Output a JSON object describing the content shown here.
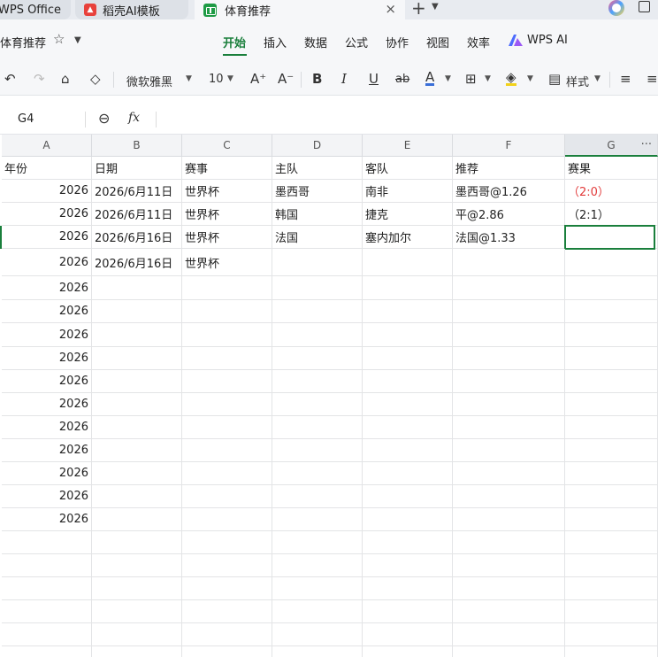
{
  "tabs": {
    "wps": "WPS Office",
    "daoke": "稻壳AI模板",
    "active": "体育推荐",
    "close": "×",
    "new": "+",
    "arrow": "⌄"
  },
  "doc": {
    "name": "体育推荐"
  },
  "menu": {
    "items": [
      "开始",
      "插入",
      "数据",
      "公式",
      "协作",
      "视图",
      "效率",
      "WPS AI"
    ],
    "active_index": 0
  },
  "toolbar": {
    "font_name": "微软雅黑",
    "font_size": "10",
    "style_label": "样式"
  },
  "formula": {
    "cell_ref": "G4",
    "fx": "fx",
    "value": ""
  },
  "sheet": {
    "columns": [
      "A",
      "B",
      "C",
      "D",
      "E",
      "F",
      "G"
    ],
    "selected_column": "G",
    "rows": [
      [
        "年份",
        "日期",
        "赛事",
        "主队",
        "客队",
        "推荐",
        "赛果"
      ],
      [
        "2026",
        "2026/6月11日",
        "世界杯",
        "墨西哥",
        "南非",
        "墨西哥@1.26",
        "（2:0）"
      ],
      [
        "2026",
        "2026/6月11日",
        "世界杯",
        "韩国",
        "捷克",
        "平@2.86",
        "（2:1）"
      ],
      [
        "2026",
        "2026/6月16日",
        "世界杯",
        "法国",
        "塞内加尔",
        "法国@1.33",
        ""
      ],
      [
        "2026",
        "2026/6月16日",
        "世界杯",
        "",
        "",
        "",
        ""
      ],
      [
        "2026",
        "",
        "",
        "",
        "",
        "",
        ""
      ],
      [
        "2026",
        "",
        "",
        "",
        "",
        "",
        ""
      ],
      [
        "2026",
        "",
        "",
        "",
        "",
        "",
        ""
      ],
      [
        "2026",
        "",
        "",
        "",
        "",
        "",
        ""
      ],
      [
        "2026",
        "",
        "",
        "",
        "",
        "",
        ""
      ],
      [
        "2026",
        "",
        "",
        "",
        "",
        "",
        ""
      ],
      [
        "2026",
        "",
        "",
        "",
        "",
        "",
        ""
      ],
      [
        "2026",
        "",
        "",
        "",
        "",
        "",
        ""
      ],
      [
        "2026",
        "",
        "",
        "",
        "",
        "",
        ""
      ],
      [
        "2026",
        "",
        "",
        "",
        "",
        "",
        ""
      ],
      [
        "2026",
        "",
        "",
        "",
        "",
        "",
        ""
      ],
      [
        "",
        "",
        "",
        "",
        "",
        "",
        ""
      ],
      [
        "",
        "",
        "",
        "",
        "",
        "",
        ""
      ],
      [
        "",
        "",
        "",
        "",
        "",
        "",
        ""
      ],
      [
        "",
        "",
        "",
        "",
        "",
        "",
        ""
      ],
      [
        "",
        "",
        "",
        "",
        "",
        "",
        ""
      ],
      [
        "",
        "",
        "",
        "",
        "",
        "",
        ""
      ]
    ],
    "colors": {
      "accent": "#1a7f3c",
      "result_red": "#e23b3b"
    }
  }
}
